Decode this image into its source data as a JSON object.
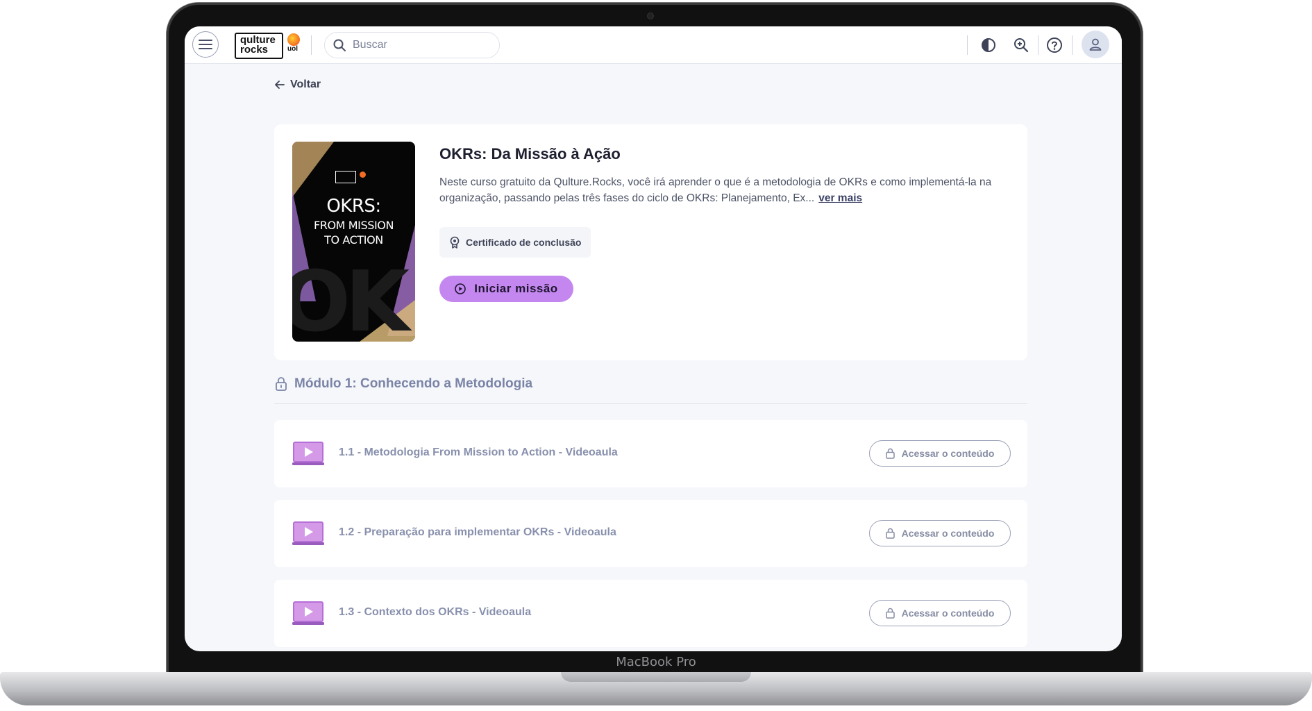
{
  "device": {
    "label": "MacBook Pro"
  },
  "header": {
    "logo_line1": "qulture",
    "logo_line2": "rocks",
    "partner_logo": "uol",
    "search_placeholder": "Buscar",
    "icons": [
      "menu-icon",
      "search-icon",
      "contrast-icon",
      "zoom-in-icon",
      "help-icon",
      "user-icon"
    ]
  },
  "nav": {
    "back_label": "Voltar"
  },
  "course": {
    "cover": {
      "title": "OKRS:",
      "subtitle_line1": "FROM MISSION",
      "subtitle_line2": "TO ACTION"
    },
    "title": "OKRs: Da Missão à Ação",
    "description": "Neste curso gratuito da Qulture.Rocks, você irá aprender o que é a metodologia de OKRs e como implementá-la na organização, passando pelas três fases do ciclo de OKRs: Planejamento, Ex...",
    "see_more": "ver mais",
    "certificate_label": "Certificado de conclusão",
    "start_button": "Iniciar missão"
  },
  "module": {
    "title": "Módulo 1: Conhecendo a Metodologia",
    "lessons": [
      {
        "title": "1.1 - Metodologia From Mission to Action - Videoaula",
        "button": "Acessar o conteúdo"
      },
      {
        "title": "1.2 - Preparação para implementar OKRs - Videoaula",
        "button": "Acessar o conteúdo"
      },
      {
        "title": "1.3 - Contexto dos OKRs - Videoaula",
        "button": "Acessar o conteúdo"
      }
    ]
  },
  "colors": {
    "accent": "#c487ef",
    "background": "#f5f7fb",
    "muted_text": "#8890ad"
  }
}
